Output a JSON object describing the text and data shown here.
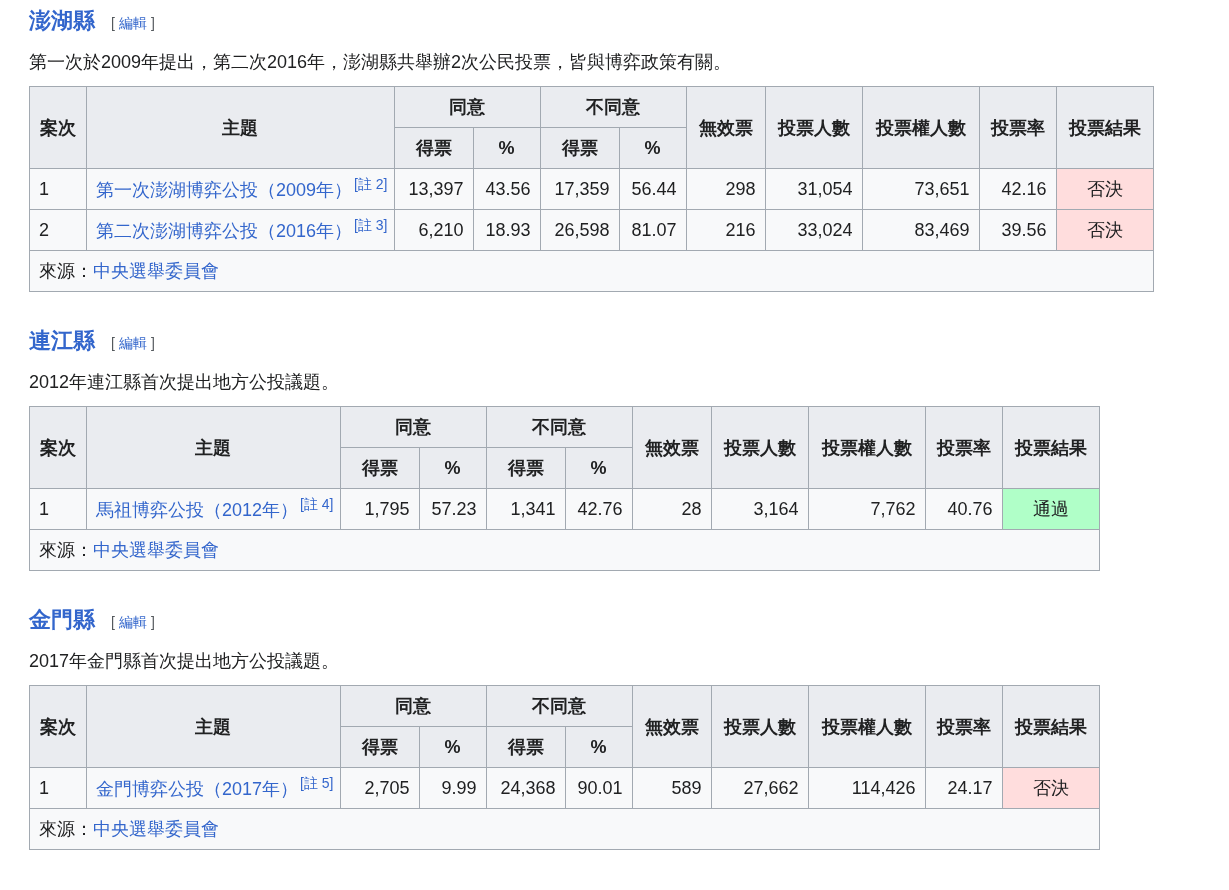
{
  "sections": [
    {
      "title": "澎湖縣",
      "edit": {
        "open": "[",
        "label": "編輯",
        "close": "]"
      },
      "intro": "第一次於2009年提出，第二次2016年，澎湖縣共舉辦2次公民投票，皆與博弈政策有關。",
      "headers": {
        "case": "案次",
        "topic": "主題",
        "agree": "同意",
        "disagree": "不同意",
        "agree_votes": "得票",
        "agree_pct": "%",
        "disagree_votes": "得票",
        "disagree_pct": "%",
        "invalid": "無效票",
        "voters": "投票人數",
        "electorate": "投票權人數",
        "turnout": "投票率",
        "result": "投票結果"
      },
      "rows": [
        {
          "case": "1",
          "topic": "第一次澎湖博弈公投（2009年）",
          "note": "[註 2]",
          "agree_votes": "13,397",
          "agree_pct": "43.56",
          "disagree_votes": "17,359",
          "disagree_pct": "56.44",
          "invalid": "298",
          "voters": "31,054",
          "electorate": "73,651",
          "turnout": "42.16",
          "result": {
            "text": "否決",
            "kind": "rejected"
          }
        },
        {
          "case": "2",
          "topic": "第二次澎湖博弈公投（2016年）",
          "note": "[註 3]",
          "agree_votes": "6,210",
          "agree_pct": "18.93",
          "disagree_votes": "26,598",
          "disagree_pct": "81.07",
          "invalid": "216",
          "voters": "33,024",
          "electorate": "83,469",
          "turnout": "39.56",
          "result": {
            "text": "否決",
            "kind": "rejected"
          }
        }
      ],
      "source": {
        "label": "來源：",
        "link": "中央選舉委員會"
      }
    },
    {
      "title": "連江縣",
      "edit": {
        "open": "[",
        "label": "編輯",
        "close": "]"
      },
      "intro": "2012年連江縣首次提出地方公投議題。",
      "headers": {
        "case": "案次",
        "topic": "主題",
        "agree": "同意",
        "disagree": "不同意",
        "agree_votes": "得票",
        "agree_pct": "%",
        "disagree_votes": "得票",
        "disagree_pct": "%",
        "invalid": "無效票",
        "voters": "投票人數",
        "electorate": "投票權人數",
        "turnout": "投票率",
        "result": "投票結果"
      },
      "rows": [
        {
          "case": "1",
          "topic": "馬祖博弈公投（2012年）",
          "note": "[註 4]",
          "agree_votes": "1,795",
          "agree_pct": "57.23",
          "disagree_votes": "1,341",
          "disagree_pct": "42.76",
          "invalid": "28",
          "voters": "3,164",
          "electorate": "7,762",
          "turnout": "40.76",
          "result": {
            "text": "通過",
            "kind": "passed"
          }
        }
      ],
      "source": {
        "label": "來源：",
        "link": "中央選舉委員會"
      }
    },
    {
      "title": "金門縣",
      "edit": {
        "open": "[",
        "label": "編輯",
        "close": "]"
      },
      "intro": "2017年金門縣首次提出地方公投議題。",
      "headers": {
        "case": "案次",
        "topic": "主題",
        "agree": "同意",
        "disagree": "不同意",
        "agree_votes": "得票",
        "agree_pct": "%",
        "disagree_votes": "得票",
        "disagree_pct": "%",
        "invalid": "無效票",
        "voters": "投票人數",
        "electorate": "投票權人數",
        "turnout": "投票率",
        "result": "投票結果"
      },
      "rows": [
        {
          "case": "1",
          "topic": "金門博弈公投（2017年）",
          "note": "[註 5]",
          "agree_votes": "2,705",
          "agree_pct": "9.99",
          "disagree_votes": "24,368",
          "disagree_pct": "90.01",
          "invalid": "589",
          "voters": "27,662",
          "electorate": "114,426",
          "turnout": "24.17",
          "result": {
            "text": "否決",
            "kind": "rejected"
          }
        }
      ],
      "source": {
        "label": "來源：",
        "link": "中央選舉委員會"
      }
    }
  ]
}
